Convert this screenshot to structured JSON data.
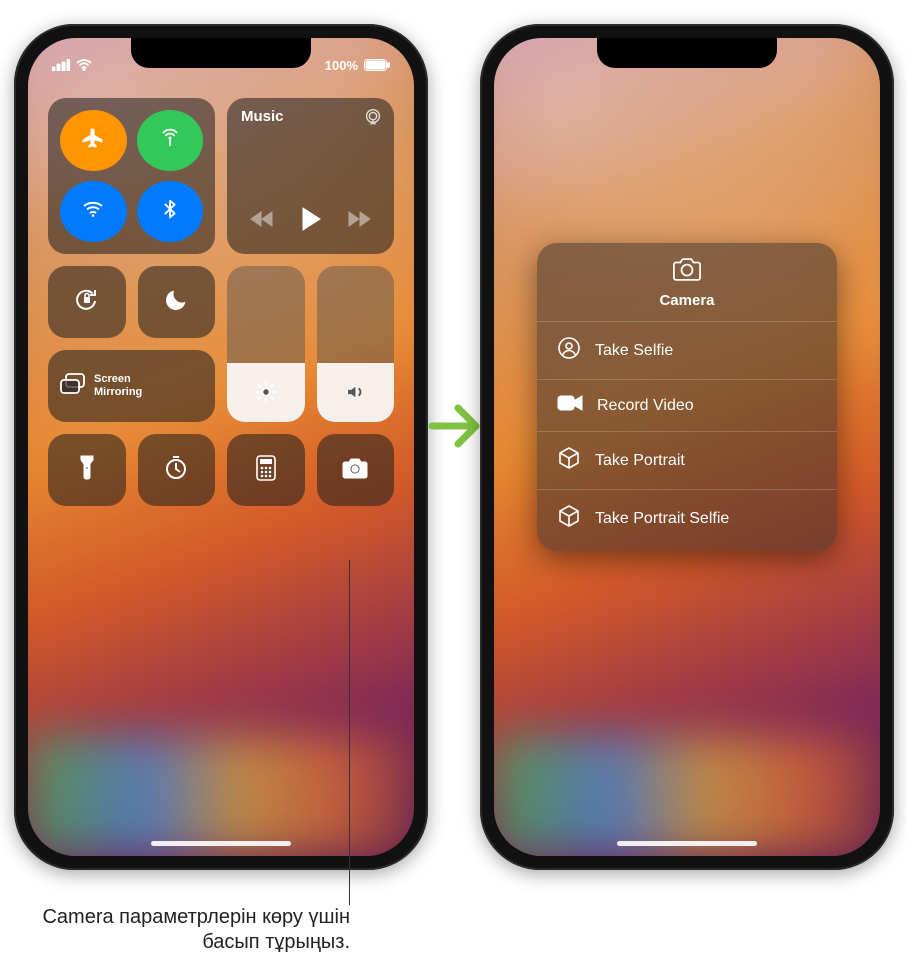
{
  "status": {
    "battery_text": "100%"
  },
  "cc": {
    "music_label": "Music",
    "screen_mirroring": "Screen\nMirroring"
  },
  "icons": {
    "airplane": "airplane-icon",
    "cellular": "cellular-antenna-icon",
    "wifi": "wifi-icon",
    "bluetooth": "bluetooth-icon",
    "airplay": "airplay-icon",
    "prev": "previous-track-icon",
    "play": "play-icon",
    "next": "next-track-icon",
    "lock_rotation": "rotation-lock-icon",
    "dnd": "moon-icon",
    "screen_mirroring": "screen-mirroring-icon",
    "brightness": "brightness-icon",
    "volume": "volume-icon",
    "flashlight": "flashlight-icon",
    "timer": "timer-icon",
    "calculator": "calculator-icon",
    "camera": "camera-icon",
    "selfie": "selfie-person-icon",
    "video": "video-camera-icon",
    "cube": "cube-icon"
  },
  "popup": {
    "title": "Camera",
    "actions": [
      {
        "label": "Take Selfie",
        "icon": "selfie"
      },
      {
        "label": "Record Video",
        "icon": "video"
      },
      {
        "label": "Take Portrait",
        "icon": "cube"
      },
      {
        "label": "Take Portrait Selfie",
        "icon": "cube"
      }
    ]
  },
  "callout": {
    "text": "Camera параметрлерін көру үшін басып тұрыңыз."
  }
}
